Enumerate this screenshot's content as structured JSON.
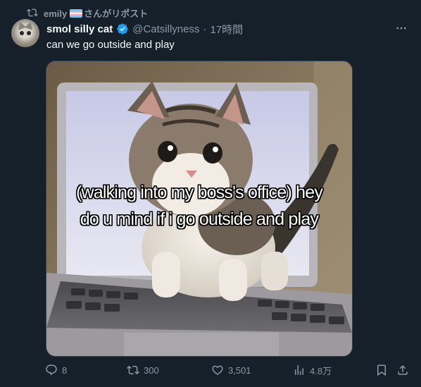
{
  "repost": {
    "user": "emily",
    "suffix": "さんがリポスト",
    "icon": "repost-icon",
    "flag": "transgender-flag-emoji"
  },
  "tweet": {
    "display_name": "smol silly cat",
    "verified": true,
    "handle": "@Catsillyness",
    "separator": "·",
    "time": "17時間",
    "text": "can we go outside and play"
  },
  "media": {
    "caption_line1": "(walking into my boss's office) hey",
    "caption_line2": "do u mind if i go outside and play"
  },
  "actions": {
    "replies": "8",
    "reposts": "300",
    "likes": "3,501",
    "views": "4.8万"
  },
  "colors": {
    "background": "#15202b",
    "text_primary": "#f7f9f9",
    "text_secondary": "#8b98a5",
    "verified_blue": "#1d9bf0",
    "border": "#38444d"
  }
}
